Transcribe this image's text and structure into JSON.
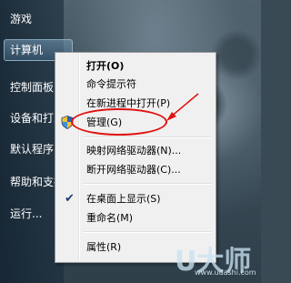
{
  "start_menu": {
    "items": [
      {
        "label": "游戏"
      },
      {
        "label": "计算机"
      },
      {
        "label": "控制面板"
      },
      {
        "label": "设备和打印机"
      },
      {
        "label": "默认程序"
      },
      {
        "label": "帮助和支持"
      },
      {
        "label": "运行..."
      }
    ]
  },
  "context_menu": {
    "items": [
      {
        "label": "打开(O)",
        "bold": true
      },
      {
        "label": "命令提示符"
      },
      {
        "label": "在新进程中打开(P)"
      },
      {
        "label": "管理(G)",
        "icon": "shield-icon"
      },
      {
        "label": "映射网络驱动器(N)..."
      },
      {
        "label": "断开网络驱动器(C)..."
      },
      {
        "label": "在桌面上显示(S)",
        "checked": true
      },
      {
        "label": "重命名(M)"
      },
      {
        "label": "属性(R)"
      }
    ]
  },
  "watermark": {
    "logo_text": "U大师",
    "url": "www.udashi.com"
  },
  "colors": {
    "annotation": "#e01010",
    "menu_bg": "#f0f0f0"
  }
}
